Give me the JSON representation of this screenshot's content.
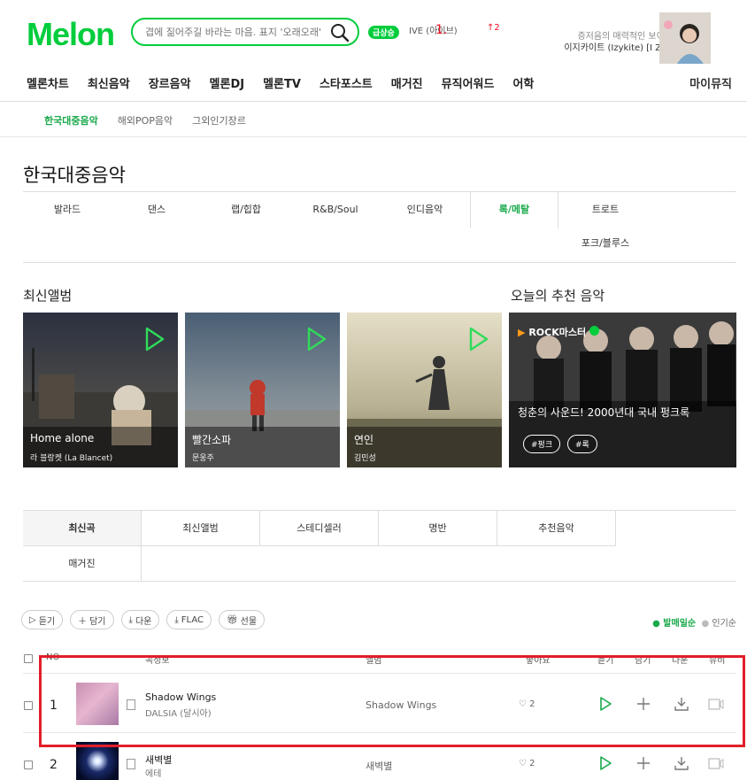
{
  "header": {
    "logo": "Melon",
    "search_placeholder": "겹에 짊어주길 바라는 마음. 표지 '오래오래'",
    "rise_badge": "급상승",
    "rise_rank": "1.",
    "rise_text": "IVE (아이브)",
    "rise_arrow": "↑2",
    "promo_sub": "증저음의 매력적인 보이스",
    "promo_title": "이지카이트 (Izykite) [I ZIP]"
  },
  "gnb": {
    "items": [
      "멜론차트",
      "최신음악",
      "장르음악",
      "멜론DJ",
      "멜론TV",
      "스타포스트",
      "매거진",
      "뮤직어워드",
      "어학"
    ],
    "my": "마이뮤직"
  },
  "sub_gnb": [
    "한국대중음악",
    "해외POP음악",
    "그외인기장르"
  ],
  "page_title": "한국대중음악",
  "genres": [
    "발라드",
    "댄스",
    "랩/힙합",
    "R&B/Soul",
    "인디음악",
    "록/메탈",
    "트로트",
    "포크/블루스"
  ],
  "sections": {
    "new_albums": "최신앨범",
    "recommend": "오늘의 추천 음악"
  },
  "albums": [
    {
      "name": "Home alone",
      "artist": "라 블랑켓 (La Blancet)"
    },
    {
      "name": "빨간소파",
      "artist": "문웅주"
    },
    {
      "name": "연인",
      "artist": "김민성"
    }
  ],
  "recommend": {
    "badge": "ROCK마스터",
    "title": "청춘의 사운드! 2000년대 국내 펑크록",
    "tags": [
      "#펑크",
      "#록"
    ]
  },
  "tabs2": [
    "최신곡",
    "최신앨범",
    "스테디셀러",
    "명반",
    "추천음악",
    "매거진"
  ],
  "toolbar": {
    "listen": "듣기",
    "add": "담기",
    "down": "다운",
    "flac": "FLAC",
    "gift": "선물"
  },
  "sort": {
    "latest": "발매일순",
    "popular": "인기순"
  },
  "table_header": {
    "no": "NO",
    "song": "곡정보",
    "album": "앨범",
    "like": "좋아요",
    "listen": "듣기",
    "add": "담기",
    "down": "다운",
    "mv": "뮤비"
  },
  "songs": [
    {
      "rank": "1",
      "title": "Shadow Wings",
      "artist": "DALSIA (달시아)",
      "album": "Shadow Wings",
      "likes": "2"
    },
    {
      "rank": "2",
      "title": "새벽별",
      "artist": "에테",
      "album": "새벽별",
      "likes": "2"
    }
  ],
  "colors": {
    "brand": "#00cd3c",
    "highlight": "#e21e2a"
  }
}
